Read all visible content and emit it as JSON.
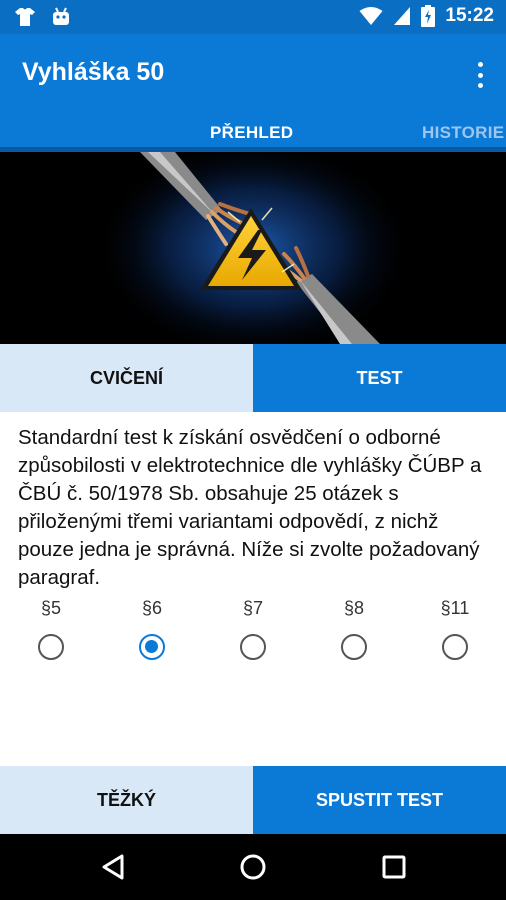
{
  "status_bar": {
    "time": "15:22",
    "icons": [
      "shirt-notification-icon",
      "android-notification-icon",
      "wifi-icon",
      "cell-signal-icon",
      "battery-charging-icon"
    ]
  },
  "app_bar": {
    "title": "Vyhláška 50",
    "menu_icon": "overflow-menu-icon"
  },
  "tabs": [
    {
      "label": "PŘEHLED",
      "selected": true
    },
    {
      "label": "HISTORIE",
      "selected": false
    }
  ],
  "banner": {
    "image": "electric-cables-warning-sign"
  },
  "mode": {
    "practice_label": "CVIČENÍ",
    "test_label": "TEST",
    "selected": "test"
  },
  "description": "Standardní test k získání osvědčení o odborné způsobilosti v elektrotechnice dle vyhlášky ČÚBP a ČBÚ č. 50/1978 Sb. obsahuje 25 otázek s přiloženými třemi variantami odpovědí, z nichž pouze jedna je správná. Níže si zvolte požadovaný paragraf.",
  "paragraphs": [
    {
      "label": "§5",
      "checked": false
    },
    {
      "label": "§6",
      "checked": true
    },
    {
      "label": "§7",
      "checked": false
    },
    {
      "label": "§8",
      "checked": false
    },
    {
      "label": "§11",
      "checked": false
    }
  ],
  "bottom": {
    "difficulty_label": "TĚŽKÝ",
    "start_label": "SPUSTIT TEST"
  },
  "nav_bar": {
    "icons": [
      "back-icon",
      "home-icon",
      "recents-icon"
    ]
  },
  "colors": {
    "primary": "#0b7ad6",
    "status_bar": "#0a6fc2",
    "light": "#d9e8f6"
  }
}
